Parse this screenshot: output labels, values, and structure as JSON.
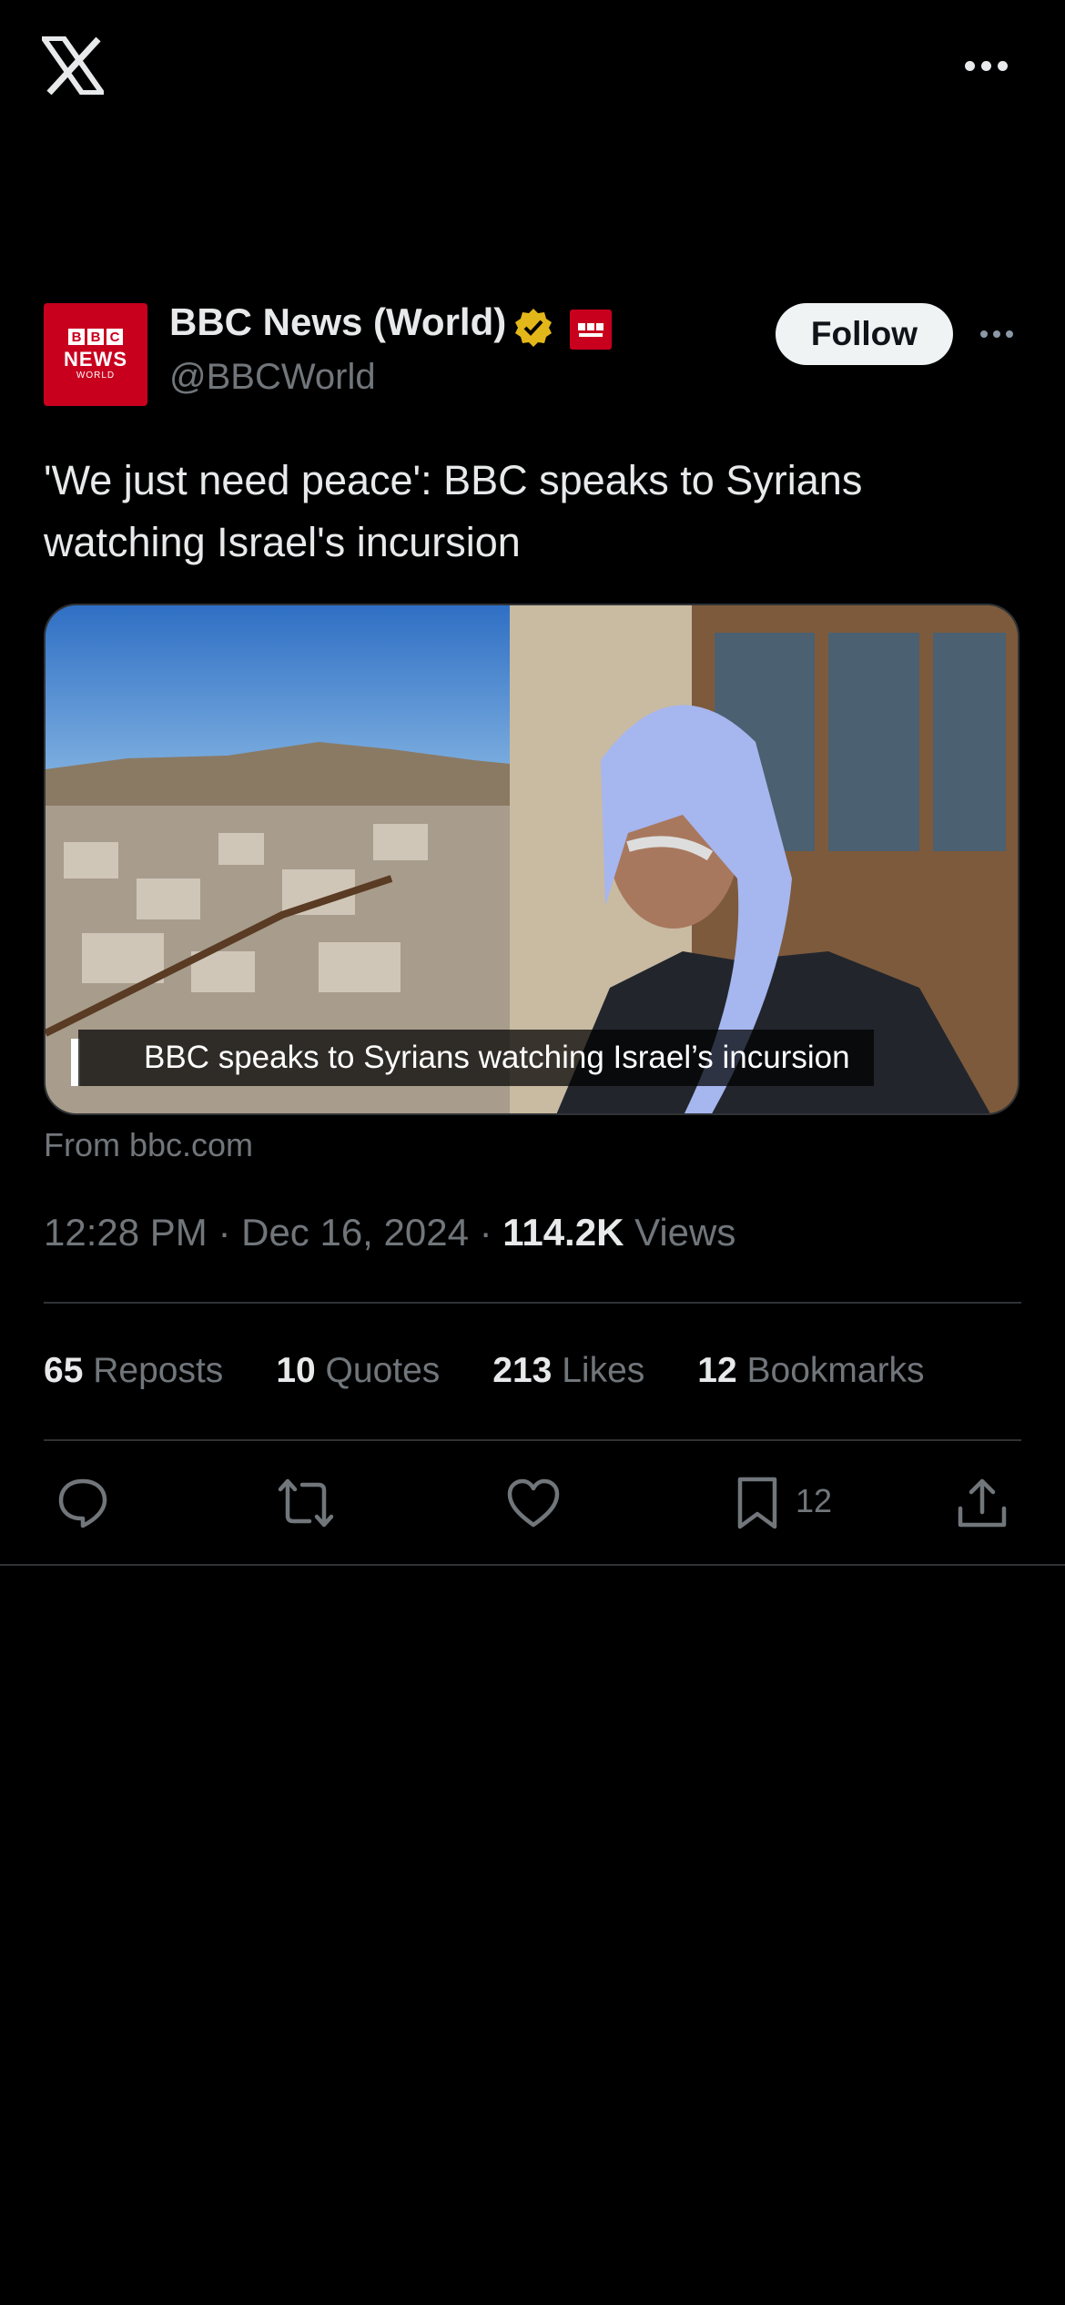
{
  "top_bar": {
    "logo_icon": "x-logo-icon",
    "more_icon": "more-horizontal-icon"
  },
  "author": {
    "avatar_text": {
      "line1": "BBC",
      "line2": "NEWS",
      "line3": "WORLD"
    },
    "name": "BBC News (World)",
    "handle": "@BBCWorld",
    "verified_icon": "gold-verified-badge-icon",
    "affiliate_icon": "bbc-news-affiliate-badge-icon"
  },
  "follow_label": "Follow",
  "tweet": {
    "text": "'We just need peace': BBC speaks to Syrians watching Israel's incursion",
    "card_caption": "BBC speaks to Syrians watching Israel’s incursion",
    "from": "From bbc.com",
    "time": "12:28 PM",
    "date": "Dec 16, 2024",
    "views_count": "114.2K",
    "views_label": "Views"
  },
  "stats": [
    {
      "count": "65",
      "label": "Reposts"
    },
    {
      "count": "10",
      "label": "Quotes"
    },
    {
      "count": "213",
      "label": "Likes"
    },
    {
      "count": "12",
      "label": "Bookmarks"
    }
  ],
  "actions": {
    "reply_icon": "reply-icon",
    "repost_icon": "repost-icon",
    "like_icon": "heart-icon",
    "bookmark_icon": "bookmark-icon",
    "bookmark_count": "12",
    "share_icon": "share-icon"
  },
  "colors": {
    "background": "#000000",
    "text": "#e7e9ea",
    "muted": "#71767b",
    "bbc_red": "#c8001e",
    "verified_gold": "#e2b719"
  }
}
